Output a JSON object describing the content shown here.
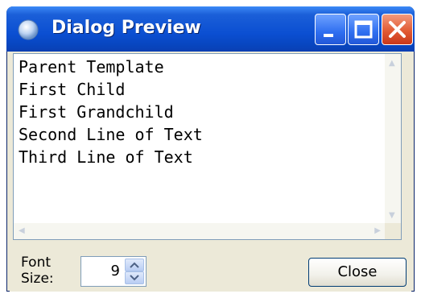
{
  "window": {
    "title": "Dialog Preview",
    "title_icon": "app-icon"
  },
  "title_buttons": {
    "minimize_icon": "minimize-icon",
    "maximize_icon": "maximize-icon",
    "close_icon": "close-icon"
  },
  "text_area": {
    "lines": [
      "Parent Template",
      "First Child",
      "First Grandchild",
      "Second Line of Text",
      "Third Line of Text"
    ]
  },
  "font_size": {
    "label_line1": "Font",
    "label_line2": "Size:",
    "value": "9"
  },
  "buttons": {
    "close_label": "Close"
  },
  "colors": {
    "titlebar": "#0b4fd2",
    "window_bg": "#ece9d8",
    "close_button": "#e25b34"
  }
}
